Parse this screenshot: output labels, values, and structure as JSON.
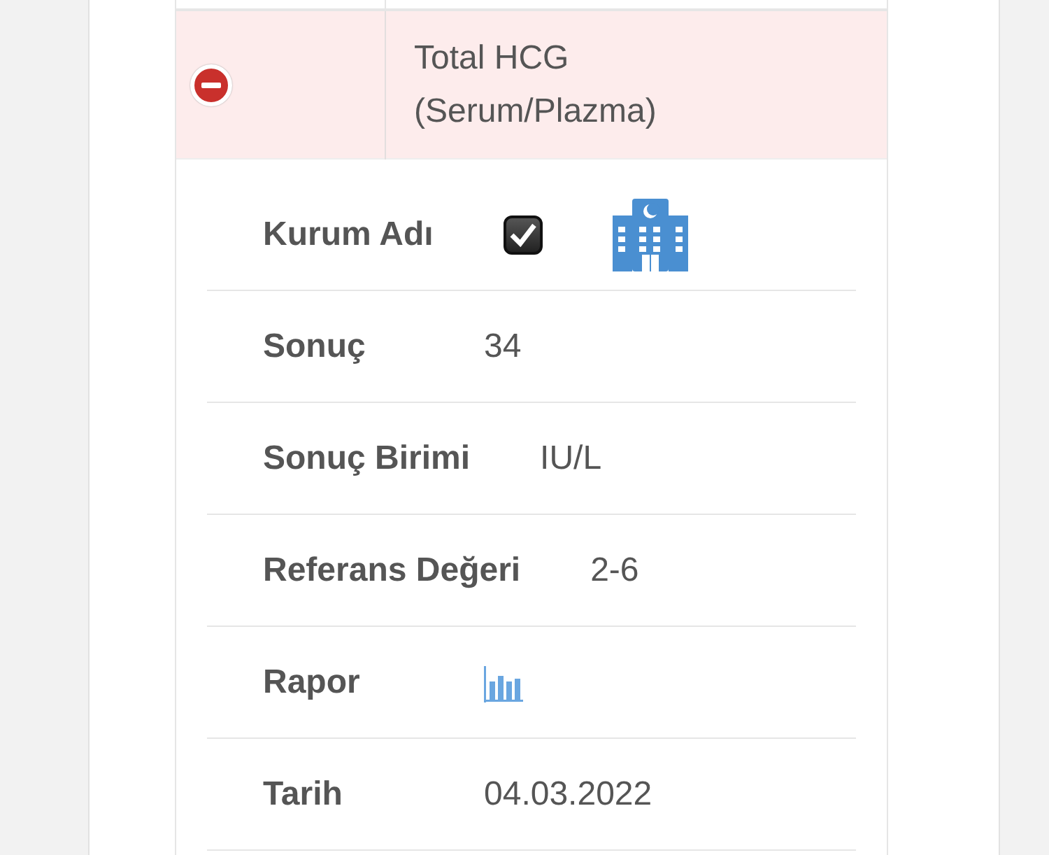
{
  "test": {
    "expanded": true,
    "name": "Total HCG (Serum/Plazma)"
  },
  "details": [
    {
      "label": "Kurum Adı",
      "kind": "institution",
      "checked": true
    },
    {
      "label": "Sonuç",
      "kind": "text",
      "value": "34"
    },
    {
      "label": "Sonuç Birimi",
      "kind": "text",
      "value": "IU/L"
    },
    {
      "label": "Referans Değeri",
      "kind": "text",
      "value": "2-6"
    },
    {
      "label": "Rapor",
      "kind": "report"
    },
    {
      "label": "Tarih",
      "kind": "text",
      "value": "04.03.2022"
    }
  ]
}
